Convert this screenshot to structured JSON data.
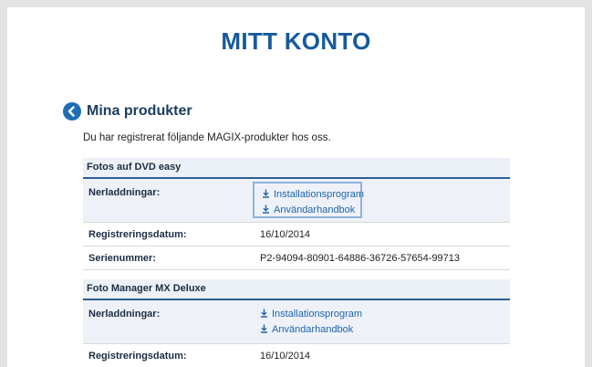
{
  "page": {
    "title": "MITT KONTO"
  },
  "section": {
    "title": "Mina produkter",
    "intro": "Du har registrerat följande MAGIX-produkter hos oss."
  },
  "products": [
    {
      "name": "Fotos auf DVD easy",
      "downloads_label": "Nerladdningar:",
      "downloads": [
        "Installationsprogram",
        "Användarhandbok"
      ],
      "reg_label": "Registreringsdatum:",
      "reg_date": "16/10/2014",
      "serial_label": "Serienummer:",
      "serial": "P2-94094-80901-64886-36726-57654-99713"
    },
    {
      "name": "Foto Manager MX Deluxe",
      "downloads_label": "Nerladdningar:",
      "downloads": [
        "Installationsprogram",
        "Användarhandbok"
      ],
      "reg_label": "Registreringsdatum:",
      "reg_date": "16/10/2014"
    }
  ],
  "colors": {
    "accent": "#155a9e",
    "link": "#1e64ad",
    "header_bg": "#ecf1f7",
    "rule": "#2c5f95"
  },
  "icons": {
    "back": "back-arrow-circle-icon",
    "download": "download-icon"
  }
}
